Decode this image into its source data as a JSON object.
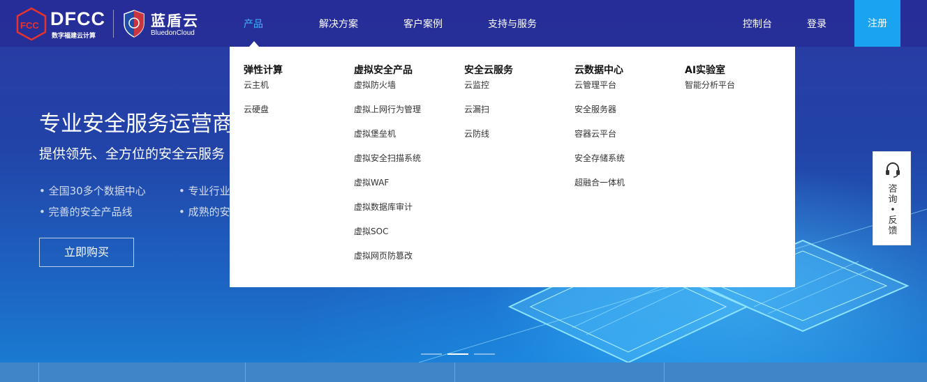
{
  "header": {
    "logo_dfcc_text": "DFCC",
    "logo_dfcc_sub": "数字福建云计算",
    "logo_blue_cn": "蓝盾云",
    "logo_blue_en": "BluedonCloud",
    "nav": [
      "产品",
      "解决方案",
      "客户案例",
      "支持与服务"
    ],
    "active_nav": "产品",
    "console": "控制台",
    "login": "登录",
    "register": "注册"
  },
  "hero": {
    "title": "专业安全服务运营商",
    "subtitle": "提供领先、全方位的安全云服务",
    "bullets": [
      "• 全国30多个数据中心",
      "• 专业行业",
      "• 完善的安全产品线",
      "• 成熟的安"
    ],
    "buy_button": "立即购买"
  },
  "dropdown": {
    "columns": [
      {
        "title": "弹性计算",
        "items": [
          "云主机",
          "云硬盘"
        ]
      },
      {
        "title": "虚拟安全产品",
        "items": [
          "虚拟防火墙",
          "虚拟上网行为管理",
          "虚拟堡垒机",
          "虚拟安全扫描系统",
          "虚拟WAF",
          "虚拟数据库审计",
          "虚拟SOC",
          "虚拟网页防篡改"
        ]
      },
      {
        "title": "安全云服务",
        "items": [
          "云监控",
          "云漏扫",
          "云防线"
        ]
      },
      {
        "title": "云数据中心",
        "items": [
          "云管理平台",
          "安全服务器",
          "容器云平台",
          "安全存储系统",
          "超融合一体机"
        ]
      },
      {
        "title": "AI实验室",
        "items": [
          "智能分析平台"
        ]
      }
    ]
  },
  "float_panel": {
    "icon": "headset-icon",
    "label_1": "咨",
    "label_2": "询",
    "label_sep": "•",
    "label_3": "反",
    "label_4": "馈"
  },
  "carousel": {
    "slides": 3,
    "active": 2
  },
  "colors": {
    "header_bg": "#262c96",
    "accent": "#3fb6ff",
    "register_bg": "#1aa3f0"
  }
}
